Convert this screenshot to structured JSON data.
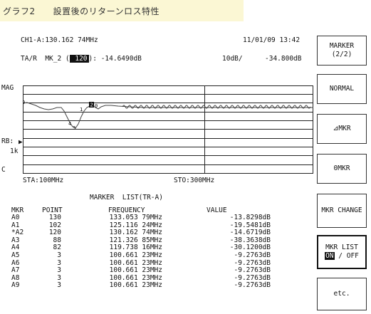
{
  "caption": "グラフ2　　設置後のリターンロス特性",
  "header": {
    "channel_info": "CH1-A:130.162 74MHz",
    "datetime": "11/01/09 13:42",
    "trace_prefix": "TA/R  MK_2 (",
    "marker_point": " 120",
    "trace_suffix": "): -14.6490dB",
    "scale": "10dB/",
    "ref_level": "-34.800dB"
  },
  "plot": {
    "mag_label": "MAG",
    "rb_label": "RB:",
    "rb_value": "1k",
    "c_label": "C",
    "start_label": "STA:100MHz",
    "stop_label": "STO:300MHz"
  },
  "marker_list": {
    "title": "MARKER  LIST(TR-A)",
    "headers": {
      "mkr": "MKR",
      "point": "POINT",
      "frequency": "FREQUENCY",
      "value": "VALUE"
    },
    "rows": [
      {
        "mkr": "A0",
        "point": "130",
        "freq": "133.053 79MHz",
        "value": "-13.8298dB"
      },
      {
        "mkr": "A1",
        "point": "102",
        "freq": "125.116 24MHz",
        "value": "-19.5481dB"
      },
      {
        "mkr": "*A2",
        "point": "120",
        "freq": "130.162 74MHz",
        "value": "-14.6719dB"
      },
      {
        "mkr": "A3",
        "point": "88",
        "freq": "121.326 85MHz",
        "value": "-38.3638dB"
      },
      {
        "mkr": "A4",
        "point": "82",
        "freq": "119.738 16MHz",
        "value": "-30.1200dB"
      },
      {
        "mkr": "A5",
        "point": "3",
        "freq": "100.661 23MHz",
        "value": "-9.2763dB"
      },
      {
        "mkr": "A6",
        "point": "3",
        "freq": "100.661 23MHz",
        "value": "-9.2763dB"
      },
      {
        "mkr": "A7",
        "point": "3",
        "freq": "100.661 23MHz",
        "value": "-9.2763dB"
      },
      {
        "mkr": "A8",
        "point": "3",
        "freq": "100.661 23MHz",
        "value": "-9.2763dB"
      },
      {
        "mkr": "A9",
        "point": "3",
        "freq": "100.661 23MHz",
        "value": "-9.2763dB"
      }
    ]
  },
  "softkeys": {
    "marker_line1": "MARKER",
    "marker_line2": "(2/2)",
    "normal": "NORMAL",
    "delta_mkr": "⊿MKR",
    "zero_mkr": "0MKR",
    "mkr_change": "MKR CHANGE",
    "mkr_list_line1": "MKR LIST",
    "mkr_list_on": "ON",
    "mkr_list_off": " / OFF",
    "etc": "etc."
  },
  "trace_marker_labels": [
    "0",
    "1",
    "2",
    "3",
    "4"
  ],
  "colors": {
    "caption_band": "#fbf7d4",
    "trace": "#444444",
    "grid": "#222222"
  }
}
